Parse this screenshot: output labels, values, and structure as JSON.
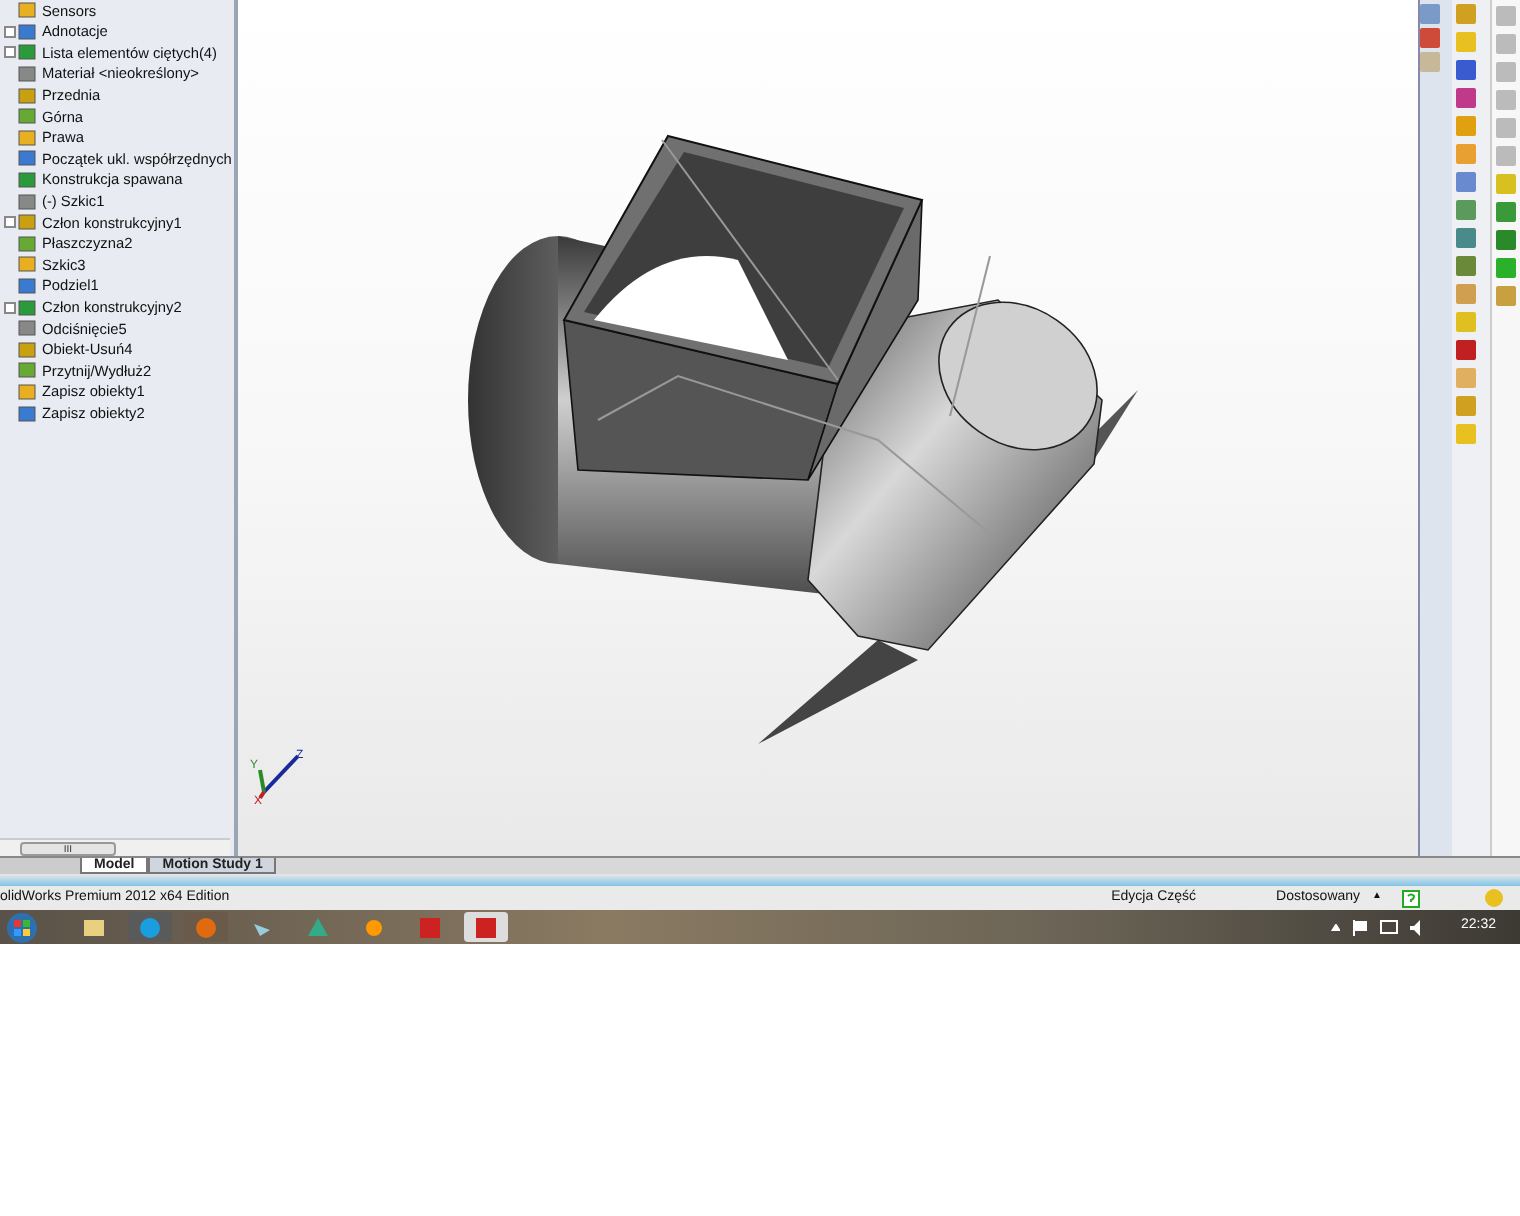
{
  "feature_tree": {
    "items": [
      {
        "label": "Sensors",
        "expandable": false
      },
      {
        "label": "Adnotacje",
        "expandable": true
      },
      {
        "label": "Lista elementów ciętych(4)",
        "expandable": true
      },
      {
        "label": "Materiał <nieokreślony>",
        "expandable": false
      },
      {
        "label": "Przednia",
        "expandable": false
      },
      {
        "label": "Górna",
        "expandable": false
      },
      {
        "label": "Prawa",
        "expandable": false
      },
      {
        "label": "Początek ukl. współrzędnych",
        "expandable": false
      },
      {
        "label": "Konstrukcja spawana",
        "expandable": false
      },
      {
        "label": "(-) Szkic1",
        "expandable": false
      },
      {
        "label": "Człon konstrukcyjny1",
        "expandable": true
      },
      {
        "label": "Płaszczyzna2",
        "expandable": false
      },
      {
        "label": "Szkic3",
        "expandable": false
      },
      {
        "label": "Podziel1",
        "expandable": false
      },
      {
        "label": "Człon konstrukcyjny2",
        "expandable": true
      },
      {
        "label": "Odciśnięcie5",
        "expandable": false
      },
      {
        "label": "Obiekt-Usuń4",
        "expandable": false
      },
      {
        "label": "Przytnij/Wydłuż2",
        "expandable": false
      },
      {
        "label": "Zapisz obiekty1",
        "expandable": false
      },
      {
        "label": "Zapisz obiekty2",
        "expandable": false
      }
    ]
  },
  "triad": {
    "x": "X",
    "y": "Y",
    "z": "Z"
  },
  "scrollbar_grip": "III",
  "tabs": [
    {
      "label": "Model",
      "selected": true
    },
    {
      "label": "Motion Study 1",
      "selected": false
    }
  ],
  "status_bar": {
    "title": "olidWorks Premium 2012 x64 Edition",
    "mode": "Edycja Część",
    "units": "Dostosowany",
    "units_caret": "▲"
  },
  "taskbar": {
    "clock": "22:32"
  }
}
